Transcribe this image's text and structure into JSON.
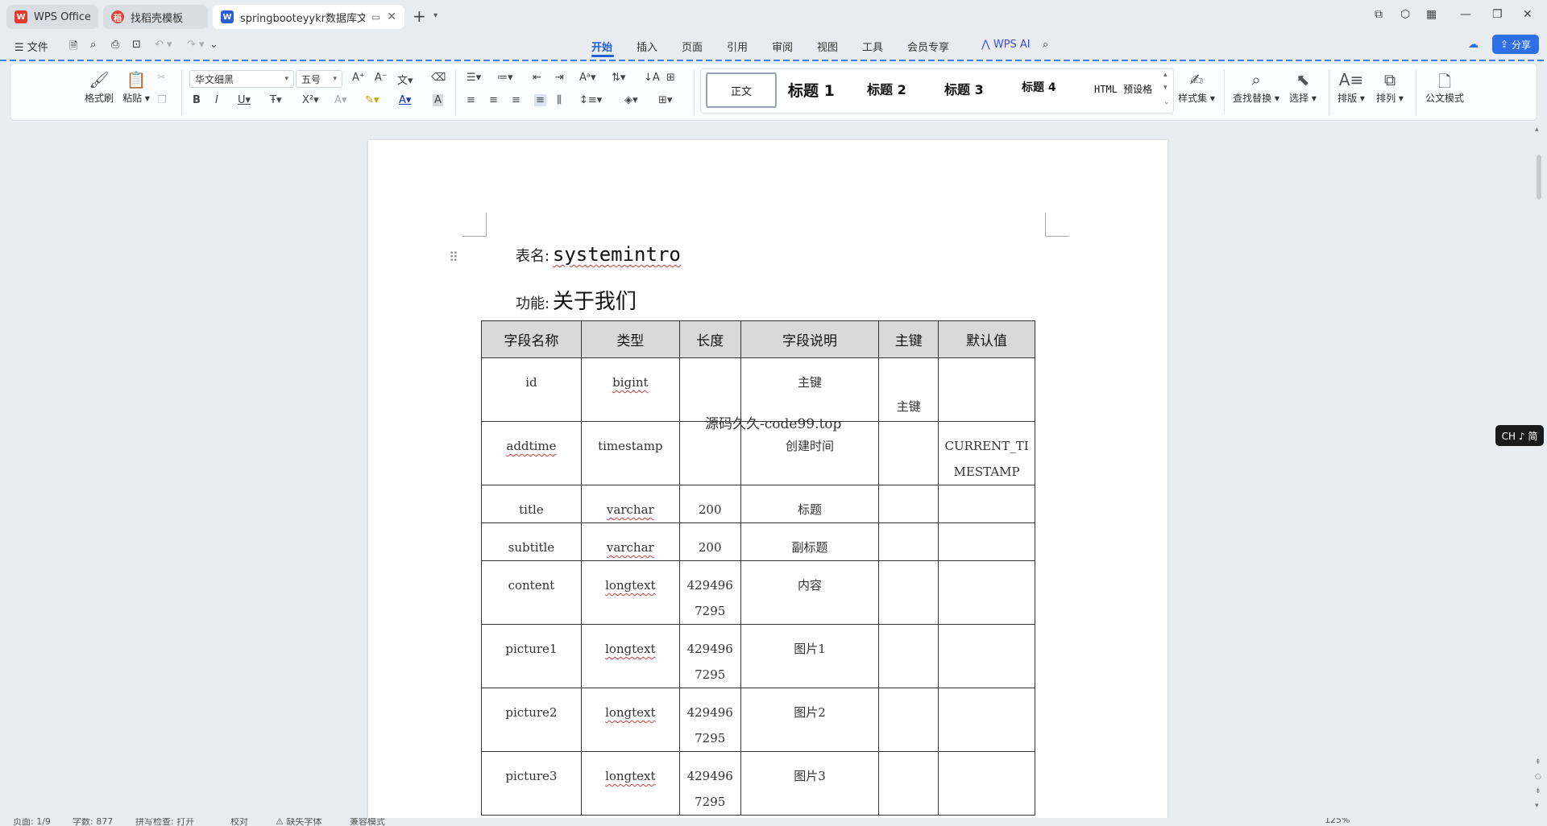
{
  "tabs": [
    {
      "label": "WPS Office",
      "icon": "wps-logo-icon",
      "color": "#e23b2e"
    },
    {
      "label": "找稻壳模板",
      "icon": "daoke-icon",
      "color": "#e2463a"
    },
    {
      "label": "springbooteyykr数据库文档",
      "icon": "word-doc-icon",
      "color": "#2b5fd6"
    }
  ],
  "menubar": {
    "file_label": "文件",
    "tabs": [
      "开始",
      "插入",
      "页面",
      "引用",
      "审阅",
      "视图",
      "工具",
      "会员专享"
    ],
    "active_tab": "开始",
    "wps_ai": "WPS AI",
    "share": "分享"
  },
  "ribbon": {
    "format_painter": "格式刷",
    "paste": "粘贴",
    "font_name": "华文细黑",
    "font_size": "五号",
    "styles": {
      "normal": "正文",
      "h1": "标题 1",
      "h2": "标题 2",
      "h3": "标题 3",
      "h4": "标题 4",
      "html": "HTML 预设格"
    },
    "style_set": "样式集",
    "find_replace": "查找替换",
    "select": "选择",
    "layout": "排版",
    "arrange": "排列",
    "official_mode": "公文模式"
  },
  "document": {
    "table_name_label": "表名:",
    "table_name": "systemintro",
    "function_label": "功能:",
    "function_value": "关于我们",
    "watermark": "源码久久-code99.top",
    "headers": [
      "字段名称",
      "类型",
      "长度",
      "字段说明",
      "主键",
      "默认值"
    ],
    "rows": [
      {
        "name": "id",
        "type": "bigint",
        "length": "",
        "desc": "主键",
        "pk": "主键",
        "default": ""
      },
      {
        "name": "addtime",
        "type": "timestamp",
        "length": "",
        "desc": "创建时间",
        "pk": "",
        "default": "CURRENT_TIMESTAMP"
      },
      {
        "name": "title",
        "type": "varchar",
        "length": "200",
        "desc": "标题",
        "pk": "",
        "default": ""
      },
      {
        "name": "subtitle",
        "type": "varchar",
        "length": "200",
        "desc": "副标题",
        "pk": "",
        "default": ""
      },
      {
        "name": "content",
        "type": "longtext",
        "length": "4294967295",
        "desc": "内容",
        "pk": "",
        "default": ""
      },
      {
        "name": "picture1",
        "type": "longtext",
        "length": "4294967295",
        "desc": "图片1",
        "pk": "",
        "default": ""
      },
      {
        "name": "picture2",
        "type": "longtext",
        "length": "4294967295",
        "desc": "图片2",
        "pk": "",
        "default": ""
      },
      {
        "name": "picture3",
        "type": "longtext",
        "length": "4294967295",
        "desc": "图片3",
        "pk": "",
        "default": ""
      }
    ]
  },
  "ime_badge": "CH ♪ 简",
  "statusbar": {
    "page": "页面: 1/9",
    "words": "字数: 877",
    "spellcheck": "拼写检查: 打开",
    "proofread": "校对",
    "missing_font": "缺失字体",
    "compat_mode": "兼容模式",
    "zoom": "125%"
  }
}
